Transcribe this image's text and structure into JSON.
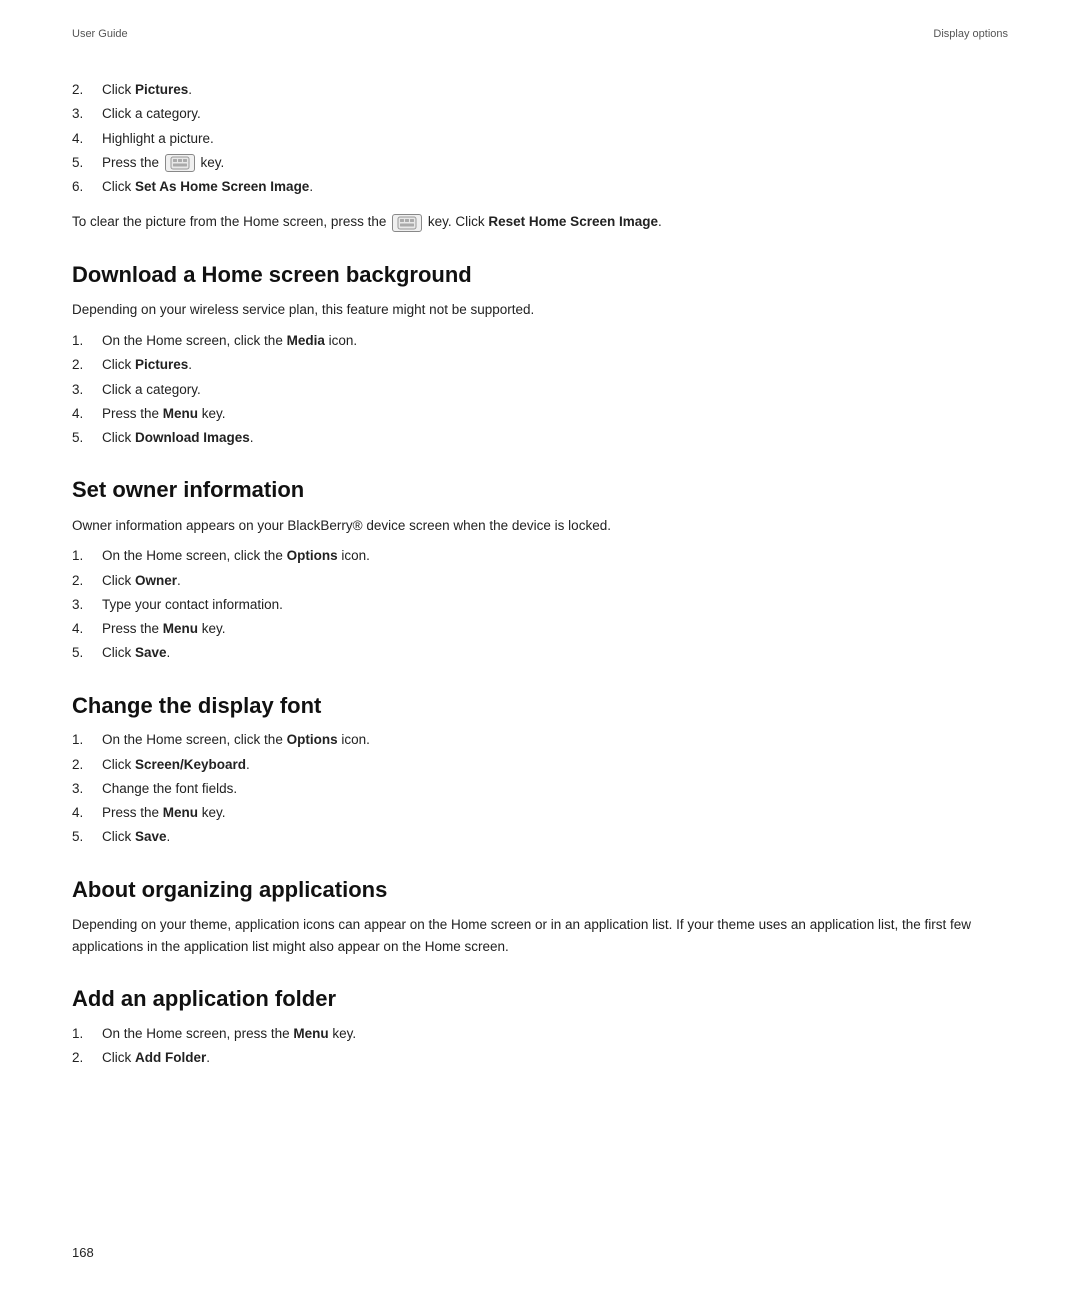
{
  "header": {
    "left": "User Guide",
    "right": "Display options"
  },
  "intro_steps": [
    {
      "num": "2.",
      "text": "Click ",
      "bold": "Pictures",
      "after": "."
    },
    {
      "num": "3.",
      "text": "Click a category.",
      "bold": null
    },
    {
      "num": "4.",
      "text": "Highlight a picture.",
      "bold": null
    },
    {
      "num": "5.",
      "text": "Press the ",
      "key": true,
      "after": " key."
    },
    {
      "num": "6.",
      "text": "Click ",
      "bold": "Set As Home Screen Image",
      "after": "."
    }
  ],
  "note": {
    "prefix": "To clear the picture from the Home screen, press the ",
    "key": true,
    "suffix": " key. Click ",
    "bold": "Reset Home Screen Image",
    "end": "."
  },
  "sections": [
    {
      "id": "download-home-screen",
      "title": "Download a Home screen background",
      "desc": "Depending on your wireless service plan, this feature might not be supported.",
      "steps": [
        {
          "num": "1.",
          "text": "On the Home screen, click the ",
          "bold": "Media",
          "after": " icon."
        },
        {
          "num": "2.",
          "text": "Click ",
          "bold": "Pictures",
          "after": "."
        },
        {
          "num": "3.",
          "text": "Click a category.",
          "bold": null
        },
        {
          "num": "4.",
          "text": "Press the ",
          "bold": "Menu",
          "after": " key."
        },
        {
          "num": "5.",
          "text": "Click ",
          "bold": "Download Images",
          "after": "."
        }
      ]
    },
    {
      "id": "set-owner-info",
      "title": "Set owner information",
      "desc": "Owner information appears on your BlackBerry® device screen when the device is locked.",
      "steps": [
        {
          "num": "1.",
          "text": "On the Home screen, click the ",
          "bold": "Options",
          "after": " icon."
        },
        {
          "num": "2.",
          "text": "Click ",
          "bold": "Owner",
          "after": "."
        },
        {
          "num": "3.",
          "text": "Type your contact information.",
          "bold": null
        },
        {
          "num": "4.",
          "text": "Press the ",
          "bold": "Menu",
          "after": " key."
        },
        {
          "num": "5.",
          "text": "Click ",
          "bold": "Save",
          "after": "."
        }
      ]
    },
    {
      "id": "change-display-font",
      "title": "Change the display font",
      "desc": null,
      "steps": [
        {
          "num": "1.",
          "text": "On the Home screen, click the ",
          "bold": "Options",
          "after": " icon."
        },
        {
          "num": "2.",
          "text": "Click ",
          "bold": "Screen/Keyboard",
          "after": "."
        },
        {
          "num": "3.",
          "text": "Change the font fields.",
          "bold": null
        },
        {
          "num": "4.",
          "text": "Press the ",
          "bold": "Menu",
          "after": " key."
        },
        {
          "num": "5.",
          "text": "Click ",
          "bold": "Save",
          "after": "."
        }
      ]
    },
    {
      "id": "about-organizing",
      "title": "About organizing applications",
      "desc": "Depending on your theme, application icons can appear on the Home screen or in an application list. If your theme uses an application list, the first few applications in the application list might also appear on the Home screen.",
      "steps": []
    },
    {
      "id": "add-application-folder",
      "title": "Add an application folder",
      "desc": null,
      "steps": [
        {
          "num": "1.",
          "text": "On the Home screen, press the ",
          "bold": "Menu",
          "after": " key."
        },
        {
          "num": "2.",
          "text": "Click ",
          "bold": "Add Folder",
          "after": "."
        }
      ]
    }
  ],
  "footer": {
    "page_number": "168"
  }
}
